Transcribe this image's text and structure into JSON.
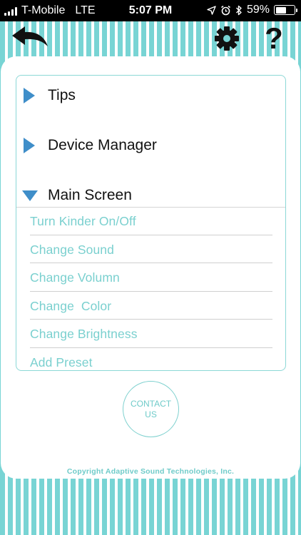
{
  "status_bar": {
    "carrier": "T-Mobile",
    "network": "LTE",
    "time": "5:07 PM",
    "battery_percent": "59%",
    "battery_level": 0.59
  },
  "header": {
    "back_icon": "back-arrow-icon",
    "settings_icon": "gear-icon",
    "help_label": "?"
  },
  "menu": {
    "sections": [
      {
        "label": "Tips",
        "expanded": false
      },
      {
        "label": "Device Manager",
        "expanded": false
      },
      {
        "label": "Main Screen",
        "expanded": true
      }
    ],
    "main_screen_items": [
      "Turn Kinder On/Off",
      "Change Sound",
      "Change Volumn",
      "Change  Color",
      "Change Brightness",
      "Add Preset"
    ]
  },
  "contact_button_label": "CONTACT US",
  "copyright": "Copyright Adaptive Sound Technologies, Inc.",
  "colors": {
    "accent_teal": "#78d4d4",
    "link_teal": "#7ad0cf",
    "arrow_blue": "#3f8ec9"
  }
}
